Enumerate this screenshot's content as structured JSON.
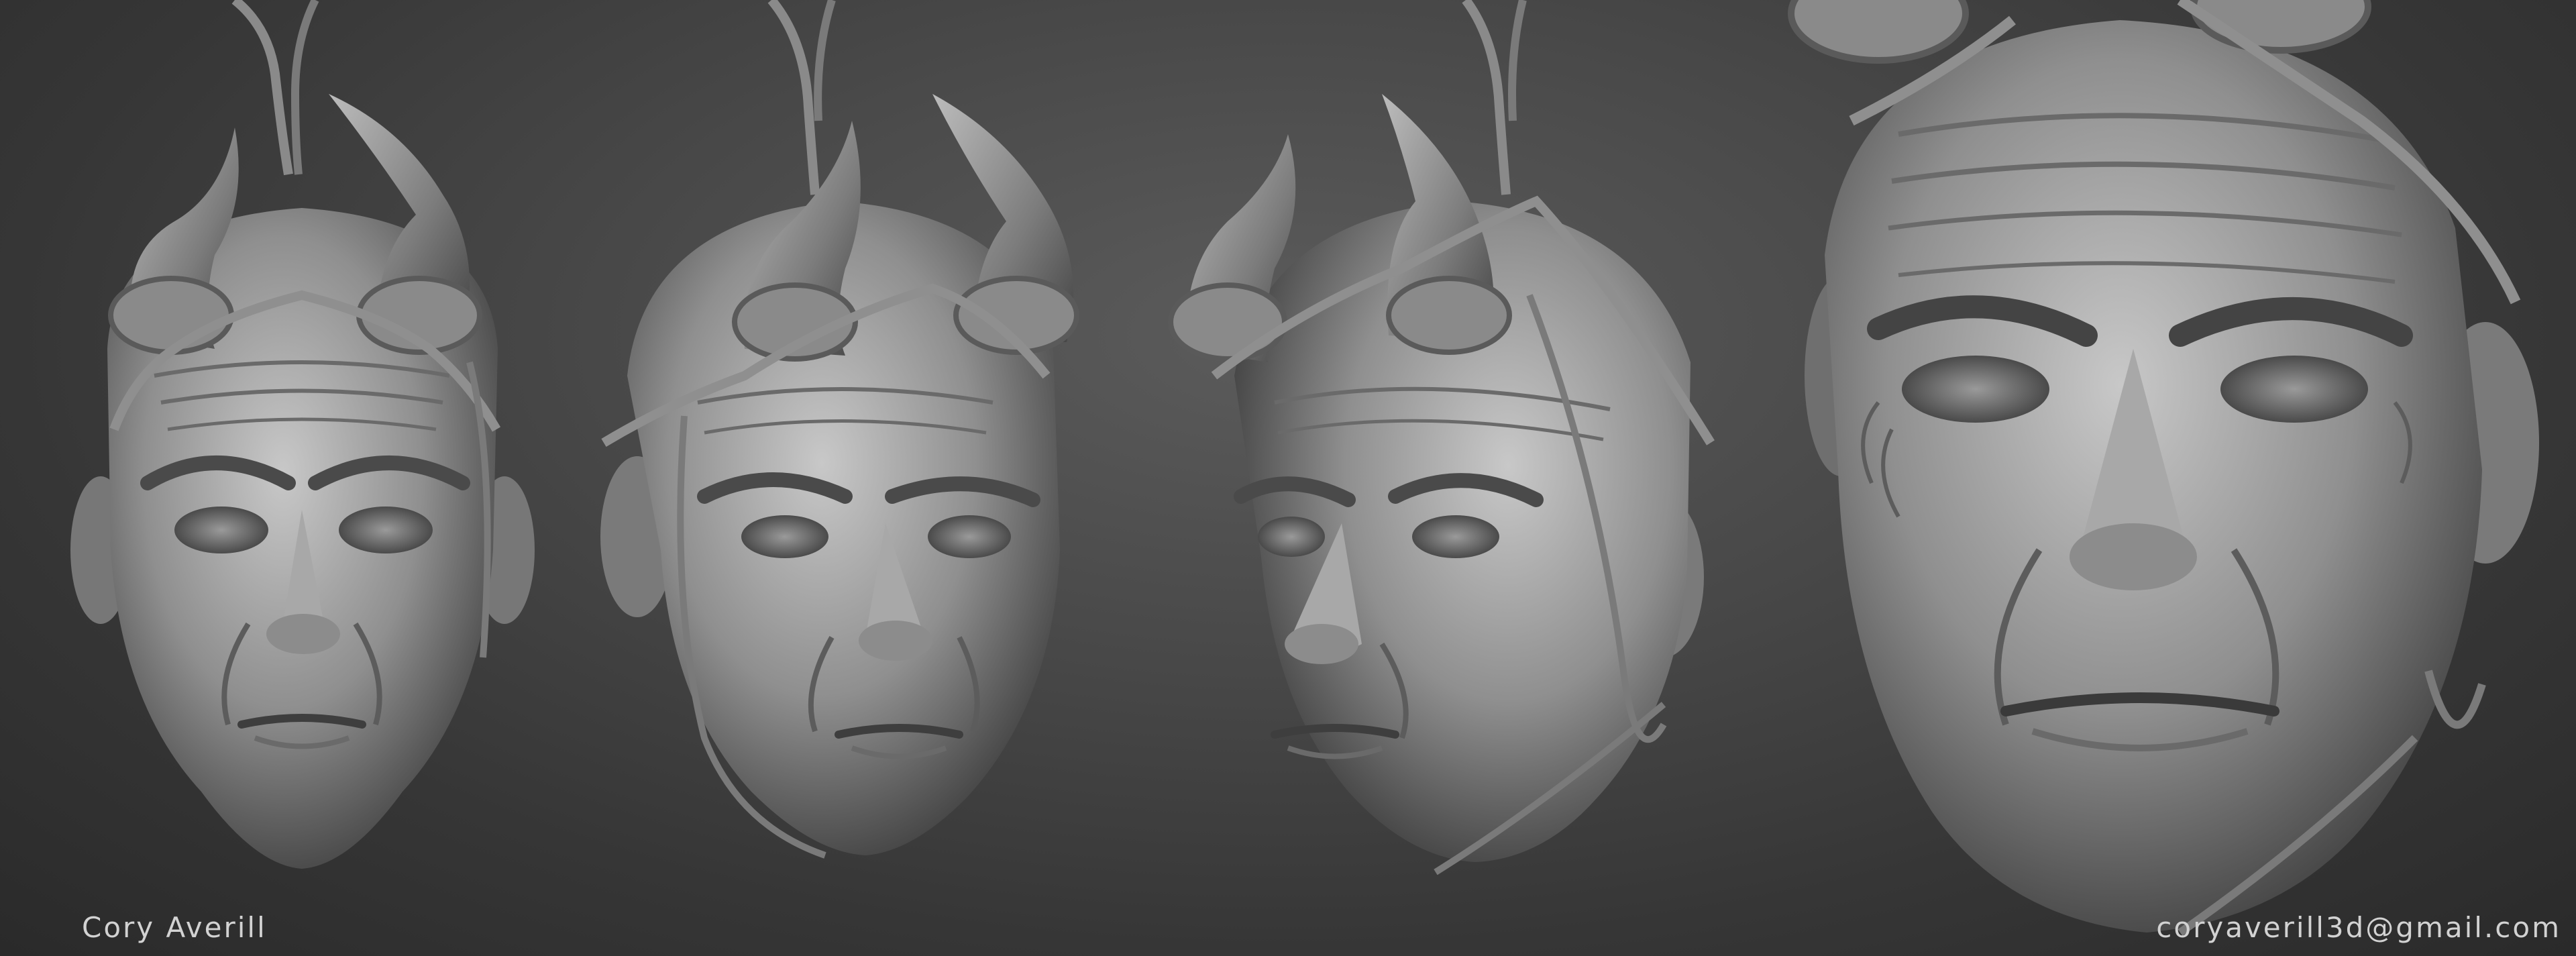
{
  "credits": {
    "artist_name": "Cory Averill",
    "artist_email": "coryaverill3d@gmail.com"
  },
  "colors": {
    "background_center": "#5c5c5c",
    "background_edge": "#2a2a2a",
    "sculpt_light": "#c4c4c4",
    "sculpt_mid": "#8a8a8a",
    "sculpt_dark": "#3c3c3c",
    "credit_text": "#d2d2d2"
  },
  "views": [
    {
      "id": "front",
      "description_icon": "head-sculpt-front"
    },
    {
      "id": "three-quarter-right",
      "description_icon": "head-sculpt-three-quarter"
    },
    {
      "id": "three-quarter-left",
      "description_icon": "head-sculpt-three-quarter-left"
    },
    {
      "id": "closeup",
      "description_icon": "head-sculpt-closeup"
    }
  ]
}
